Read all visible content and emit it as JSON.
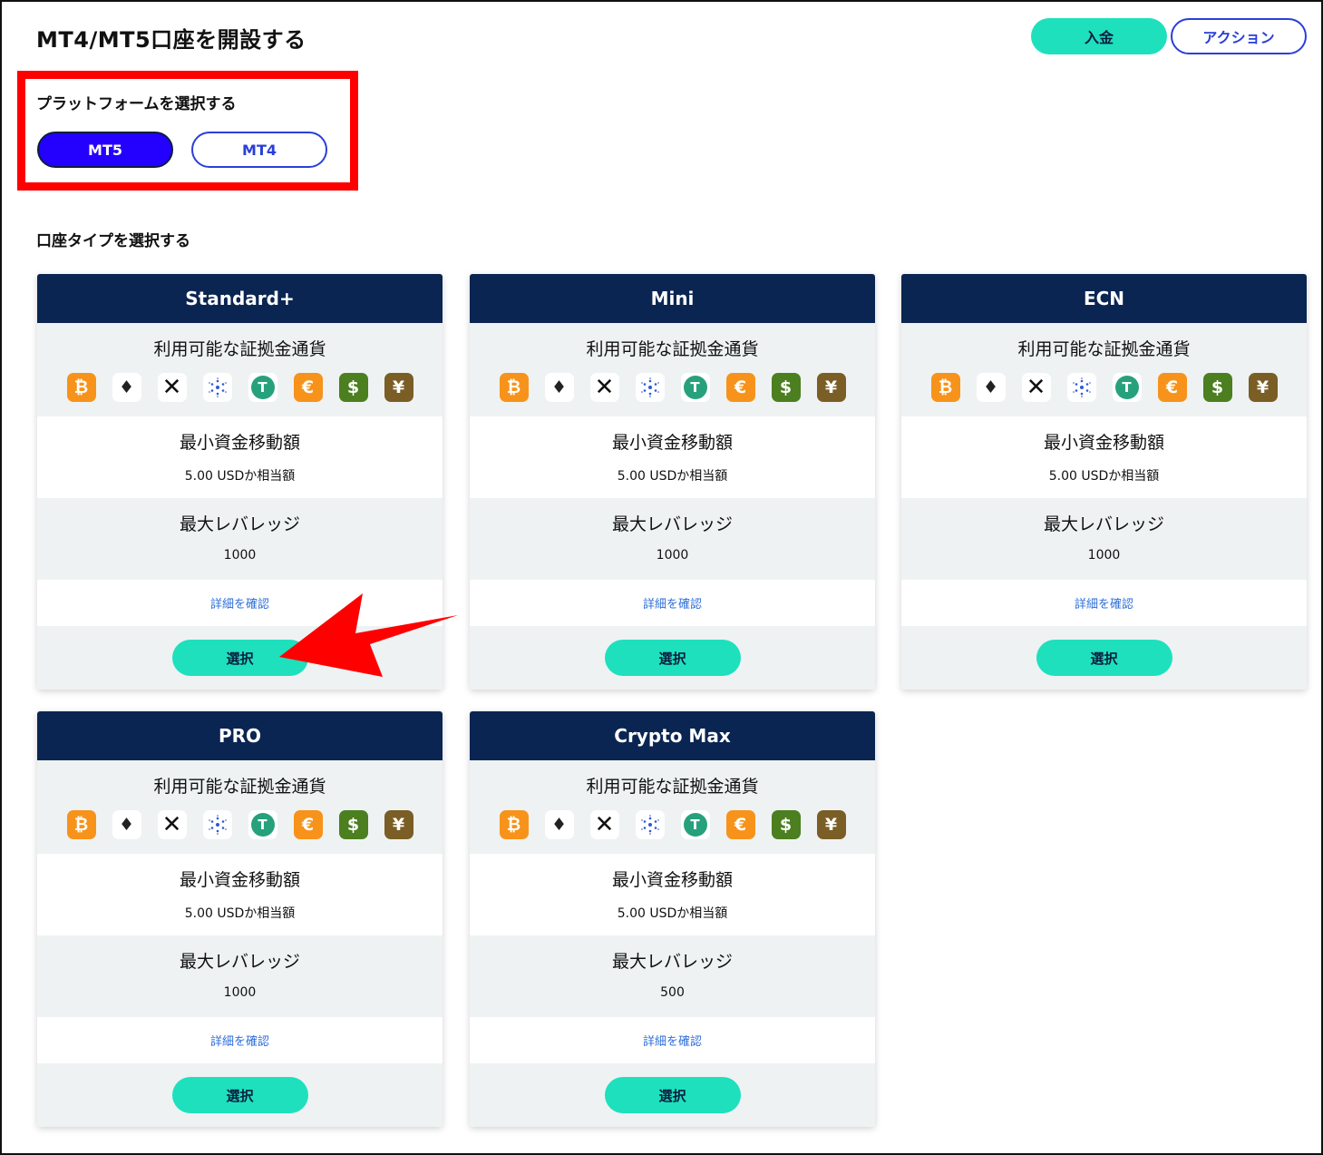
{
  "header": {
    "title": "MT4/MT5口座を開設する",
    "deposit_label": "入金",
    "action_label": "アクション"
  },
  "platform": {
    "title": "プラットフォームを選択する",
    "options": [
      "MT5",
      "MT4"
    ],
    "selected": "MT5"
  },
  "account_type_title": "口座タイプを選択する",
  "colors": {
    "accent_teal": "#1ee0bd",
    "navy": "#0b2552",
    "selected_blue": "#2400ff",
    "highlight_red": "#ff0000"
  },
  "currency_icons": [
    "bitcoin-icon",
    "ethereum-icon",
    "xrp-icon",
    "cardano-icon",
    "tether-icon",
    "euro-icon",
    "dollar-icon",
    "yen-icon"
  ],
  "cards": [
    {
      "name": "Standard+",
      "currency_label": "利用可能な証拠金通貨",
      "min_label": "最小資金移動額",
      "min_value": "5.00 USDか相当額",
      "lev_label": "最大レバレッジ",
      "lev_value": "1000",
      "link": "詳細を確認",
      "select": "選択"
    },
    {
      "name": "Mini",
      "currency_label": "利用可能な証拠金通貨",
      "min_label": "最小資金移動額",
      "min_value": "5.00 USDか相当額",
      "lev_label": "最大レバレッジ",
      "lev_value": "1000",
      "link": "詳細を確認",
      "select": "選択"
    },
    {
      "name": "ECN",
      "currency_label": "利用可能な証拠金通貨",
      "min_label": "最小資金移動額",
      "min_value": "5.00 USDか相当額",
      "lev_label": "最大レバレッジ",
      "lev_value": "1000",
      "link": "詳細を確認",
      "select": "選択"
    },
    {
      "name": "PRO",
      "currency_label": "利用可能な証拠金通貨",
      "min_label": "最小資金移動額",
      "min_value": "5.00 USDか相当額",
      "lev_label": "最大レバレッジ",
      "lev_value": "1000",
      "link": "詳細を確認",
      "select": "選択"
    },
    {
      "name": "Crypto Max",
      "currency_label": "利用可能な証拠金通貨",
      "min_label": "最小資金移動額",
      "min_value": "5.00 USDか相当額",
      "lev_label": "最大レバレッジ",
      "lev_value": "500",
      "link": "詳細を確認",
      "select": "選択"
    }
  ]
}
